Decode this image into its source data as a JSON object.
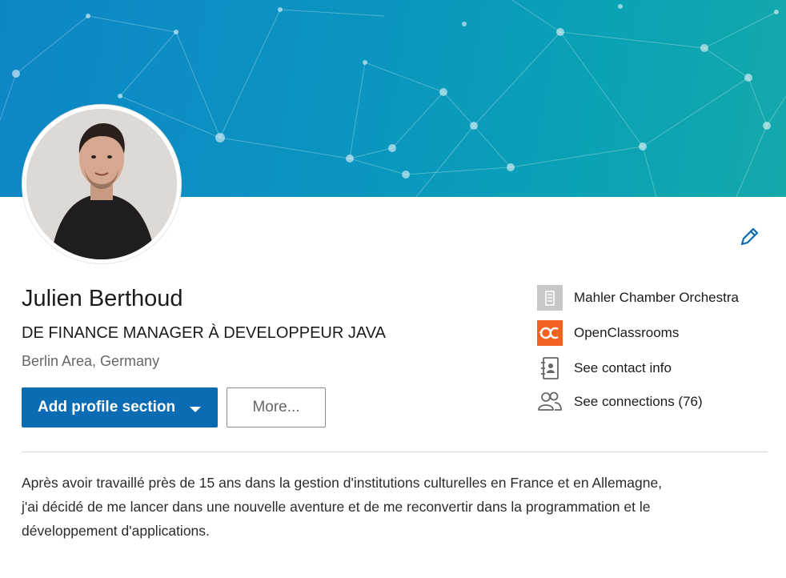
{
  "profile": {
    "name": "Julien Berthoud",
    "headline": "DE FINANCE MANAGER À DEVELOPPEUR JAVA",
    "location": "Berlin Area, Germany"
  },
  "actions": {
    "add_section_label": "Add profile section",
    "more_label": "More..."
  },
  "sidebar": {
    "items": [
      {
        "label": "Mahler Chamber Orchestra",
        "icon": "company-logo-icon"
      },
      {
        "label": "OpenClassrooms",
        "icon": "openclassrooms-logo-icon"
      },
      {
        "label": "See contact info",
        "icon": "contact-book-icon"
      },
      {
        "label": "See connections (76)",
        "icon": "people-icon"
      }
    ]
  },
  "summary": {
    "lines": [
      "Après avoir travaillé près de 15 ans dans la gestion d'institutions culturelles en France et en Allemagne,",
      "j'ai décidé de me lancer dans une nouvelle aventure et de me reconvertir dans la programmation et le",
      "développement d'applications."
    ]
  },
  "colors": {
    "accent": "#0b6bb3",
    "banner_start": "#0e86c6",
    "banner_end": "#14a9aa",
    "openclassrooms": "#f0621e"
  }
}
